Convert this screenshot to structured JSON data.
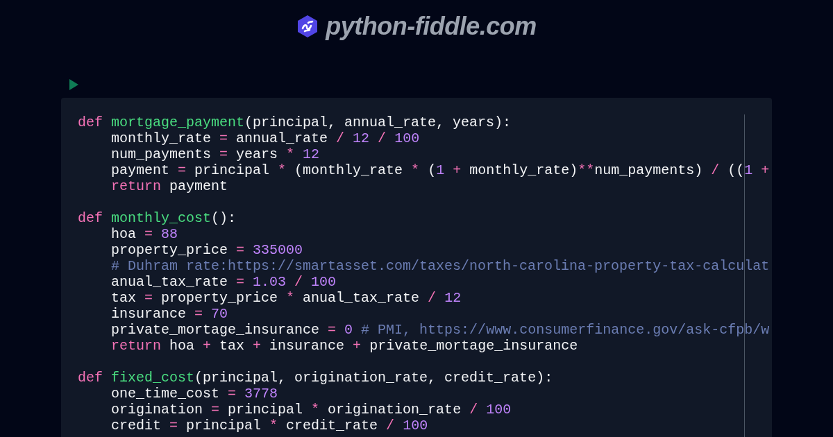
{
  "header": {
    "site_title": "python-fiddle.com"
  },
  "code_blocks": [
    {
      "header": [
        {
          "kind": "keyword",
          "text": "def "
        },
        {
          "kind": "function",
          "text": "mortgage_payment"
        },
        {
          "kind": "plain",
          "text": "(principal, annual_rate, years):"
        }
      ],
      "children": [
        [
          {
            "kind": "plain",
            "text": "monthly_rate "
          },
          {
            "kind": "operator",
            "text": "="
          },
          {
            "kind": "plain",
            "text": " annual_rate "
          },
          {
            "kind": "operator",
            "text": "/ "
          },
          {
            "kind": "number",
            "text": "12"
          },
          {
            "kind": "operator",
            "text": " / "
          },
          {
            "kind": "number",
            "text": "100"
          }
        ],
        [
          {
            "kind": "plain",
            "text": "num_payments "
          },
          {
            "kind": "operator",
            "text": "="
          },
          {
            "kind": "plain",
            "text": " years "
          },
          {
            "kind": "operator",
            "text": "* "
          },
          {
            "kind": "number",
            "text": "12"
          }
        ],
        [
          {
            "kind": "plain",
            "text": "payment "
          },
          {
            "kind": "operator",
            "text": "="
          },
          {
            "kind": "plain",
            "text": " principal "
          },
          {
            "kind": "operator",
            "text": "*"
          },
          {
            "kind": "plain",
            "text": " (monthly_rate "
          },
          {
            "kind": "operator",
            "text": "*"
          },
          {
            "kind": "plain",
            "text": " ("
          },
          {
            "kind": "number",
            "text": "1"
          },
          {
            "kind": "operator",
            "text": " +"
          },
          {
            "kind": "plain",
            "text": " monthly_rate)"
          },
          {
            "kind": "operator",
            "text": "**"
          },
          {
            "kind": "plain",
            "text": "num_payments) "
          },
          {
            "kind": "operator",
            "text": "/"
          },
          {
            "kind": "plain",
            "text": " (("
          },
          {
            "kind": "number",
            "text": "1"
          },
          {
            "kind": "operator",
            "text": " +"
          }
        ],
        [
          {
            "kind": "keyword",
            "text": "return"
          },
          {
            "kind": "plain",
            "text": " payment"
          }
        ]
      ]
    },
    {
      "header": [
        {
          "kind": "keyword",
          "text": "def "
        },
        {
          "kind": "function",
          "text": "monthly_cost"
        },
        {
          "kind": "plain",
          "text": "():"
        }
      ],
      "children": [
        [
          {
            "kind": "plain",
            "text": "hoa "
          },
          {
            "kind": "operator",
            "text": "= "
          },
          {
            "kind": "number",
            "text": "88"
          }
        ],
        [
          {
            "kind": "plain",
            "text": "property_price "
          },
          {
            "kind": "operator",
            "text": "= "
          },
          {
            "kind": "number",
            "text": "335000"
          }
        ],
        [
          {
            "kind": "comment",
            "text": "# Duhram rate:https://smartasset.com/taxes/north-carolina-property-tax-calculat"
          }
        ],
        [
          {
            "kind": "plain",
            "text": "anual_tax_rate "
          },
          {
            "kind": "operator",
            "text": "= "
          },
          {
            "kind": "number",
            "text": "1.03"
          },
          {
            "kind": "operator",
            "text": " / "
          },
          {
            "kind": "number",
            "text": "100"
          }
        ],
        [
          {
            "kind": "plain",
            "text": "tax "
          },
          {
            "kind": "operator",
            "text": "="
          },
          {
            "kind": "plain",
            "text": " property_price "
          },
          {
            "kind": "operator",
            "text": "*"
          },
          {
            "kind": "plain",
            "text": " anual_tax_rate "
          },
          {
            "kind": "operator",
            "text": "/ "
          },
          {
            "kind": "number",
            "text": "12"
          }
        ],
        [
          {
            "kind": "plain",
            "text": "insurance "
          },
          {
            "kind": "operator",
            "text": "= "
          },
          {
            "kind": "number",
            "text": "70"
          }
        ],
        [
          {
            "kind": "plain",
            "text": "private_mortage_insurance "
          },
          {
            "kind": "operator",
            "text": "= "
          },
          {
            "kind": "number",
            "text": "0"
          },
          {
            "kind": "comment",
            "text": " # PMI, https://www.consumerfinance.gov/ask-cfpb/w"
          }
        ],
        [
          {
            "kind": "keyword",
            "text": "return"
          },
          {
            "kind": "plain",
            "text": " hoa "
          },
          {
            "kind": "operator",
            "text": "+"
          },
          {
            "kind": "plain",
            "text": " tax "
          },
          {
            "kind": "operator",
            "text": "+"
          },
          {
            "kind": "plain",
            "text": " insurance "
          },
          {
            "kind": "operator",
            "text": "+"
          },
          {
            "kind": "plain",
            "text": " private_mortage_insurance"
          }
        ]
      ]
    },
    {
      "header": [
        {
          "kind": "keyword",
          "text": "def "
        },
        {
          "kind": "function",
          "text": "fixed_cost"
        },
        {
          "kind": "plain",
          "text": "(principal, origination_rate, credit_rate):"
        }
      ],
      "children": [
        [
          {
            "kind": "plain",
            "text": "one_time_cost "
          },
          {
            "kind": "operator",
            "text": "= "
          },
          {
            "kind": "number",
            "text": "3778"
          }
        ],
        [
          {
            "kind": "plain",
            "text": "origination "
          },
          {
            "kind": "operator",
            "text": "="
          },
          {
            "kind": "plain",
            "text": " principal "
          },
          {
            "kind": "operator",
            "text": "*"
          },
          {
            "kind": "plain",
            "text": " origination_rate "
          },
          {
            "kind": "operator",
            "text": "/ "
          },
          {
            "kind": "number",
            "text": "100"
          }
        ],
        [
          {
            "kind": "plain",
            "text": "credit "
          },
          {
            "kind": "operator",
            "text": "="
          },
          {
            "kind": "plain",
            "text": " principal "
          },
          {
            "kind": "operator",
            "text": "*"
          },
          {
            "kind": "plain",
            "text": " credit_rate "
          },
          {
            "kind": "operator",
            "text": "/ "
          },
          {
            "kind": "number",
            "text": "100"
          }
        ]
      ]
    }
  ]
}
